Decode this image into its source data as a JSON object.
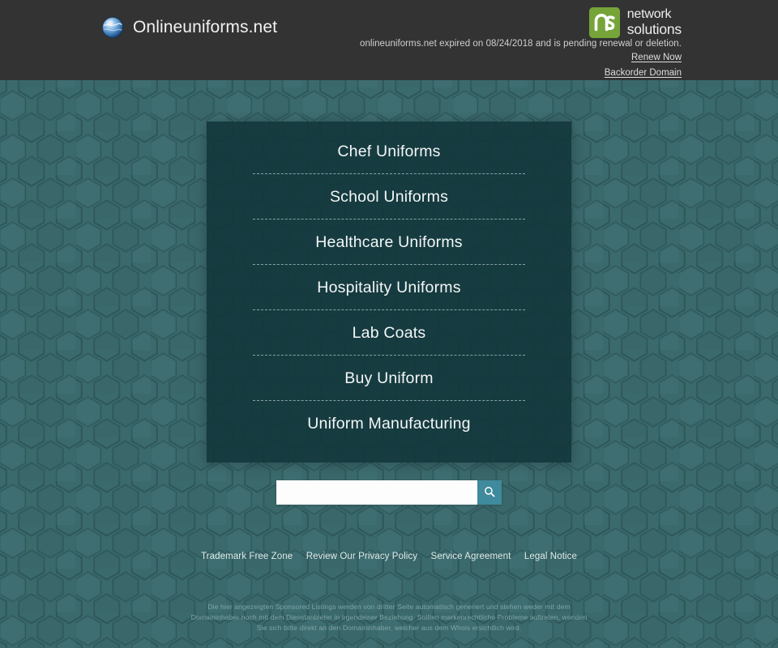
{
  "header": {
    "brand_title": "Onlineuniforms.net",
    "globe_icon": "globe-icon",
    "ns_logo": {
      "mark_text": "ns",
      "word_top": "network",
      "word_bottom": "solutions"
    },
    "expiry_notice": "onlineuniforms.net expired on 08/24/2018 and is pending renewal or deletion.",
    "links": [
      {
        "label": "Renew Now"
      },
      {
        "label": "Backorder Domain"
      }
    ],
    "bar_color": "#333333"
  },
  "panel": {
    "links": [
      {
        "label": "Chef Uniforms"
      },
      {
        "label": "School Uniforms"
      },
      {
        "label": "Healthcare Uniforms"
      },
      {
        "label": "Hospitality Uniforms"
      },
      {
        "label": "Lab Coats"
      },
      {
        "label": "Buy Uniform"
      },
      {
        "label": "Uniform Manufacturing"
      }
    ],
    "background_color": "#11353a"
  },
  "search": {
    "value": "",
    "placeholder": "",
    "button_icon": "search-icon",
    "button_color": "#3f8a9c"
  },
  "footer": {
    "links": [
      {
        "label": "Trademark Free Zone"
      },
      {
        "label": "Review Our Privacy Policy"
      },
      {
        "label": "Service Agreement"
      },
      {
        "label": "Legal Notice"
      }
    ],
    "disclaimer": "Die hier angezeigten Sponsored Listings werden von dritter Seite automatisch generiert und stehen weder mit dem Domaininhaber noch mit dem Dienstanbieter in irgendeiner Beziehung. Sollten markenrechtliche Probleme auftreten, wenden Sie sich bitte direkt an den Domaininhaber, welcher aus dem Whois ersichtlich wird."
  },
  "theme": {
    "background_teal": "#3b6a6d",
    "accent_green": "#76a439"
  }
}
